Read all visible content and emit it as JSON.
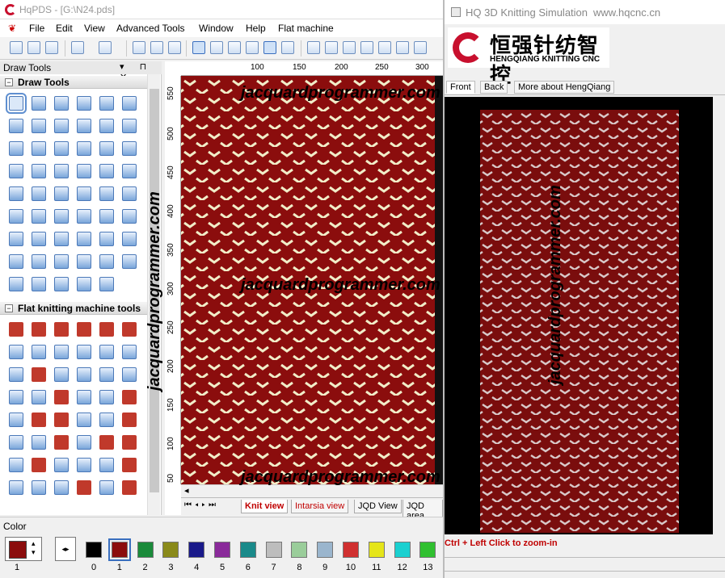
{
  "main": {
    "title": "HqPDS - [G:\\N24.pds]",
    "menu": [
      "File",
      "Edit",
      "View",
      "Advanced Tools",
      "Window",
      "Help",
      "Flat machine"
    ]
  },
  "panel": {
    "title": "Draw Tools",
    "sections": [
      {
        "label": "Draw Tools"
      },
      {
        "label": "Flat knitting machine tools"
      }
    ]
  },
  "canvas": {
    "h_ruler": [
      "100",
      "150",
      "200",
      "250",
      "300"
    ],
    "v_ruler": [
      "550",
      "500",
      "450",
      "400",
      "350",
      "300",
      "250",
      "200",
      "150",
      "100",
      "50"
    ],
    "tabs": [
      {
        "label": "Knit view",
        "active": true
      },
      {
        "label": "Intarsia view",
        "active": false
      },
      {
        "label": "JQD View",
        "active": false
      },
      {
        "label": "JQD area",
        "active": false
      }
    ]
  },
  "colors": {
    "title": "Color",
    "current_label": "1",
    "swatches": [
      {
        "label": "0",
        "color": "#000000"
      },
      {
        "label": "1",
        "color": "#8b0d0d"
      },
      {
        "label": "2",
        "color": "#1a8a3a"
      },
      {
        "label": "3",
        "color": "#8a8a1a"
      },
      {
        "label": "4",
        "color": "#1a1a8a"
      },
      {
        "label": "5",
        "color": "#8a2a9a"
      },
      {
        "label": "6",
        "color": "#1a8a8a"
      },
      {
        "label": "7",
        "color": "#bdbdbd"
      },
      {
        "label": "8",
        "color": "#9acd9a"
      },
      {
        "label": "9",
        "color": "#9ab5cd"
      },
      {
        "label": "10",
        "color": "#d03030"
      },
      {
        "label": "11",
        "color": "#e5e51a"
      },
      {
        "label": "12",
        "color": "#1ad0d0"
      },
      {
        "label": "13",
        "color": "#30c030"
      }
    ]
  },
  "sim": {
    "title": "HQ 3D Knitting Simulation",
    "url": "www.hqcnc.cn",
    "logo_cn": "恒强针纺智控",
    "logo_en": "HENGQIANG KNITTING CNC",
    "tabs": [
      "Front",
      "Back",
      "More about HengQiang"
    ],
    "zoom_hint": "Ctrl + Left Click to zoom-in"
  },
  "watermark": "jacquardprogrammer.com"
}
